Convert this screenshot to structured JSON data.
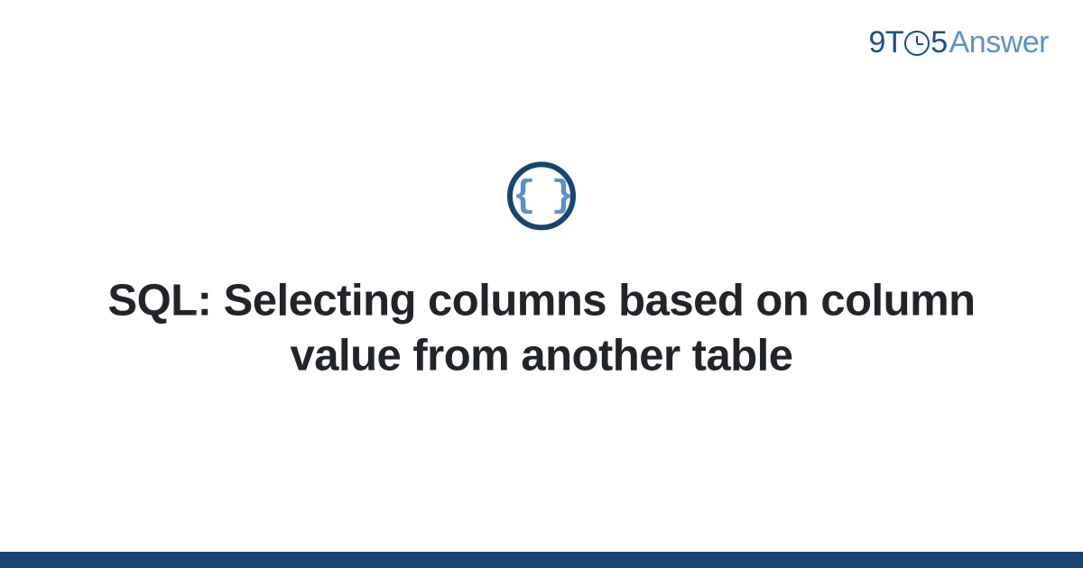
{
  "brand": {
    "part1": "9T",
    "part2": "5",
    "part3": "Answer"
  },
  "icon": {
    "glyph": "{ }"
  },
  "title": "SQL: Selecting columns based on column value from another table",
  "colors": {
    "primary": "#17456f",
    "accent": "#5b91c9"
  }
}
